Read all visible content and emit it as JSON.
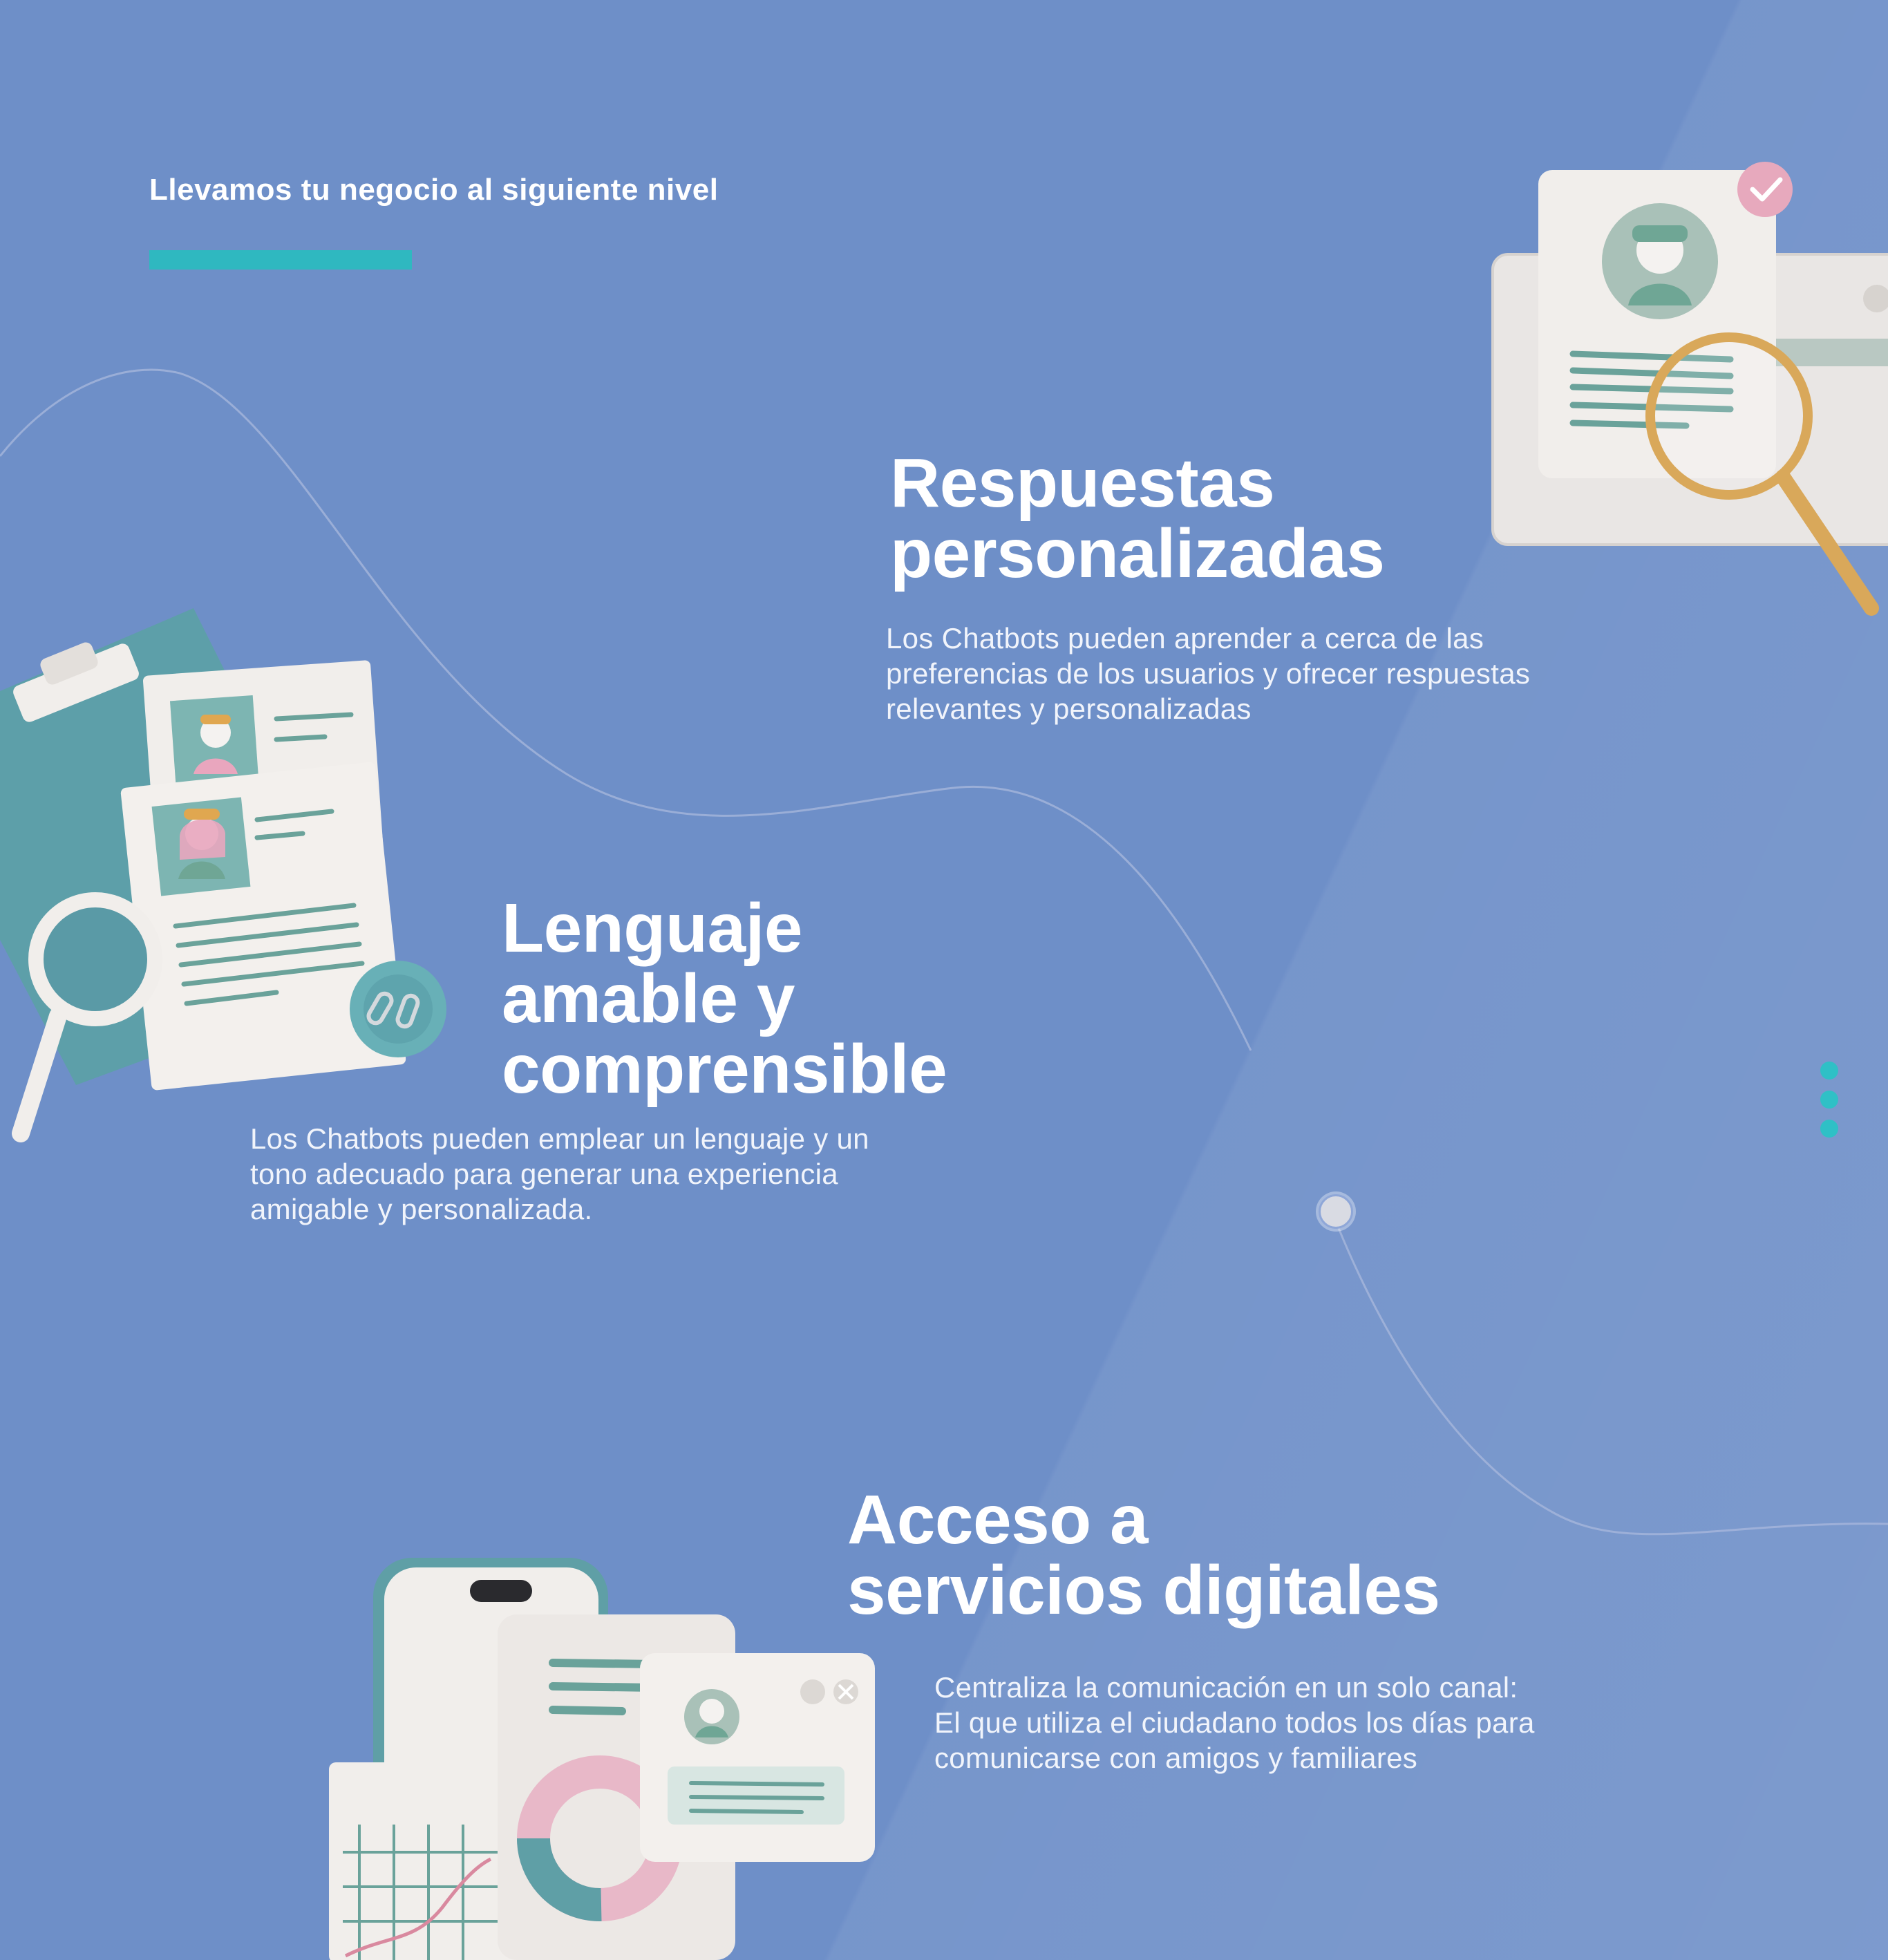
{
  "header": {
    "eyebrow": "Llevamos tu negocio al siguiente nivel"
  },
  "features": [
    {
      "title": "Respuestas\npersonalizadas",
      "description": "Los Chatbots pueden aprender a cerca de las\npreferencias de los usuarios y ofrecer respuestas\nrelevantes y personalizadas"
    },
    {
      "title": "Lenguaje\namable y\ncomprensible",
      "description": "Los Chatbots pueden emplear un lenguaje y un\ntono adecuado para generar una experiencia\namigable y personalizada."
    },
    {
      "title": "Acceso a\nservicios digitales",
      "description": "Centraliza la comunicación en un solo canal:\nEl que utiliza el ciudadano todos los días para\ncomunicarse con amigos y familiares"
    }
  ],
  "colors": {
    "background": "#6e8fc8",
    "accent": "#2fb8c0",
    "text": "#ffffff"
  },
  "icons": [
    "resume-magnifier-illustration",
    "clipboard-profiles-illustration",
    "phone-chart-chat-illustration",
    "check-badge-icon",
    "vertical-dots-indicator"
  ]
}
